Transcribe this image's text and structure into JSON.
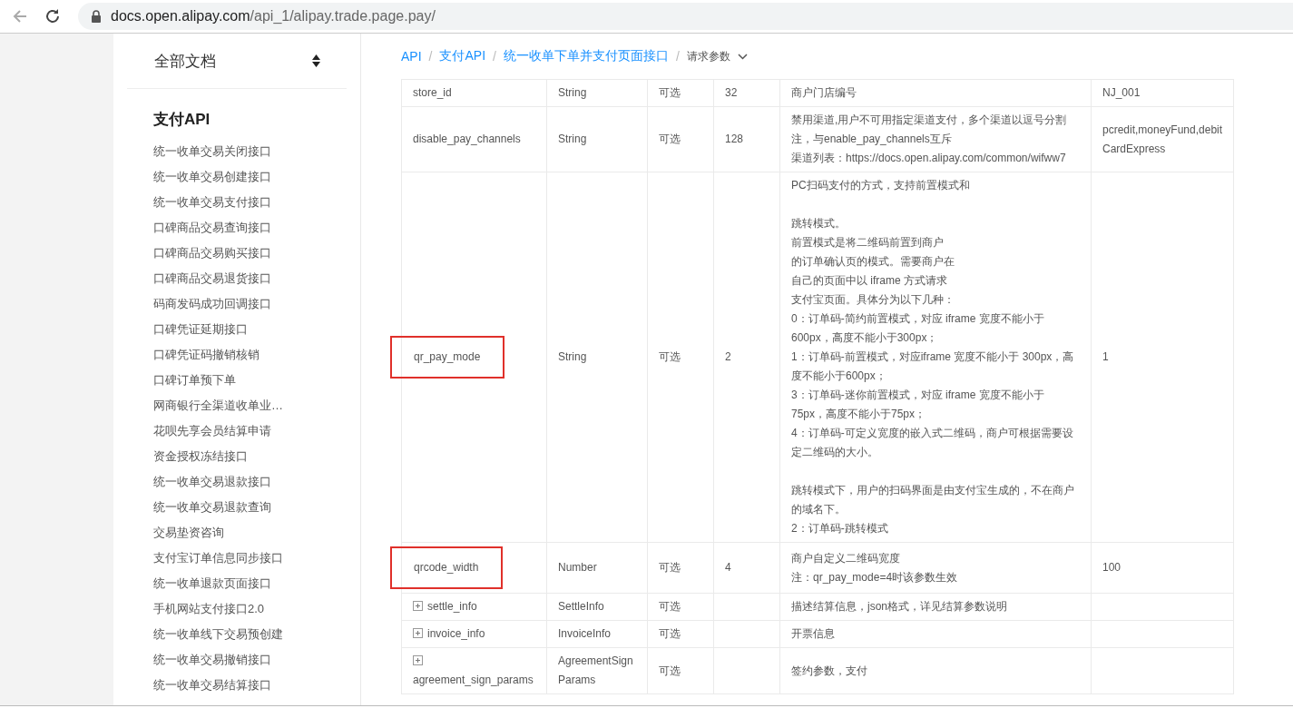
{
  "browser": {
    "url_domain": "docs.open.alipay.com",
    "url_path": "/api_1/alipay.trade.page.pay/",
    "back_disabled": true
  },
  "sidebar": {
    "title": "全部文档",
    "section": "支付API",
    "items": [
      {
        "label": "统一收单交易关闭接口",
        "selected": false
      },
      {
        "label": "统一收单交易创建接口",
        "selected": false
      },
      {
        "label": "统一收单交易支付接口",
        "selected": false
      },
      {
        "label": "口碑商品交易查询接口",
        "selected": false
      },
      {
        "label": "口碑商品交易购买接口",
        "selected": false
      },
      {
        "label": "口碑商品交易退货接口",
        "selected": false
      },
      {
        "label": "码商发码成功回调接口",
        "selected": false
      },
      {
        "label": "口碑凭证延期接口",
        "selected": false
      },
      {
        "label": "口碑凭证码撤销核销",
        "selected": false
      },
      {
        "label": "口碑订单预下单",
        "selected": false
      },
      {
        "label": "网商银行全渠道收单业…",
        "selected": false
      },
      {
        "label": "花呗先享会员结算申请",
        "selected": false
      },
      {
        "label": "资金授权冻结接口",
        "selected": false
      },
      {
        "label": "统一收单交易退款接口",
        "selected": false
      },
      {
        "label": "统一收单交易退款查询",
        "selected": false
      },
      {
        "label": "交易垫资咨询",
        "selected": false
      },
      {
        "label": "支付宝订单信息同步接口",
        "selected": false
      },
      {
        "label": "统一收单退款页面接口",
        "selected": false
      },
      {
        "label": "手机网站支付接口2.0",
        "selected": false
      },
      {
        "label": "统一收单线下交易预创建",
        "selected": false
      },
      {
        "label": "统一收单交易撤销接口",
        "selected": false
      },
      {
        "label": "统一收单交易结算接口",
        "selected": false
      }
    ]
  },
  "breadcrumb": {
    "separator": "/",
    "items": [
      "API",
      "支付API",
      "统一收单下单并支付页面接口",
      "请求参数"
    ]
  },
  "table": {
    "rows": [
      {
        "name": "store_id",
        "expandable": false,
        "highlighted": false,
        "type": "String",
        "required": "可选",
        "max_length": "32",
        "description": [
          [
            "商户门店编号"
          ]
        ],
        "example": "NJ_001"
      },
      {
        "name": "disable_pay_channels",
        "expandable": false,
        "highlighted": false,
        "type": "String",
        "required": "可选",
        "max_length": "128",
        "description": [
          [
            "禁用渠道,用户不可用指定渠道支付，多个渠道以逗号分割",
            "注，与enable_pay_channels互斥",
            "渠道列表：https://docs.open.alipay.com/common/wifww7"
          ]
        ],
        "example": "pcredit,moneyFund,debit\nCardExpress"
      },
      {
        "name": "qr_pay_mode",
        "expandable": false,
        "highlighted": true,
        "type": "String",
        "required": "可选",
        "max_length": "2",
        "description": [
          [
            "PC扫码支付的方式，支持前置模式和"
          ],
          [
            "跳转模式。",
            "前置模式是将二维码前置到商户",
            "的订单确认页的模式。需要商户在",
            "自己的页面中以 iframe 方式请求",
            "支付宝页面。具体分为以下几种：",
            "0：订单码-简约前置模式，对应 iframe 宽度不能小于",
            "600px，高度不能小于300px；",
            "1：订单码-前置模式，对应iframe 宽度不能小于 300px，高",
            "度不能小于600px；",
            "3：订单码-迷你前置模式，对应 iframe 宽度不能小于",
            "75px，高度不能小于75px；",
            "4：订单码-可定义宽度的嵌入式二维码，商户可根据需要设",
            "定二维码的大小。"
          ],
          [
            "跳转模式下，用户的扫码界面是由支付宝生成的，不在商户",
            "的域名下。",
            "2：订单码-跳转模式"
          ]
        ],
        "example": "1"
      },
      {
        "name": "qrcode_width",
        "expandable": false,
        "highlighted": true,
        "type": "Number",
        "required": "可选",
        "max_length": "4",
        "description": [
          [
            "商户自定义二维码宽度",
            "注：qr_pay_mode=4时该参数生效"
          ]
        ],
        "example": "100"
      },
      {
        "name": "settle_info",
        "expandable": true,
        "highlighted": false,
        "type": "SettleInfo",
        "required": "可选",
        "max_length": "",
        "description": [
          [
            "描述结算信息，json格式，详见结算参数说明"
          ]
        ],
        "example": ""
      },
      {
        "name": "invoice_info",
        "expandable": true,
        "highlighted": false,
        "type": "InvoiceInfo",
        "required": "可选",
        "max_length": "",
        "description": [
          [
            "开票信息"
          ]
        ],
        "example": ""
      },
      {
        "name": "agreement_sign_params",
        "expandable": true,
        "highlighted": false,
        "type": "AgreementSign\nParams",
        "required": "可选",
        "max_length": "",
        "description": [
          [
            "签约参数，支付"
          ]
        ],
        "example": ""
      }
    ]
  }
}
